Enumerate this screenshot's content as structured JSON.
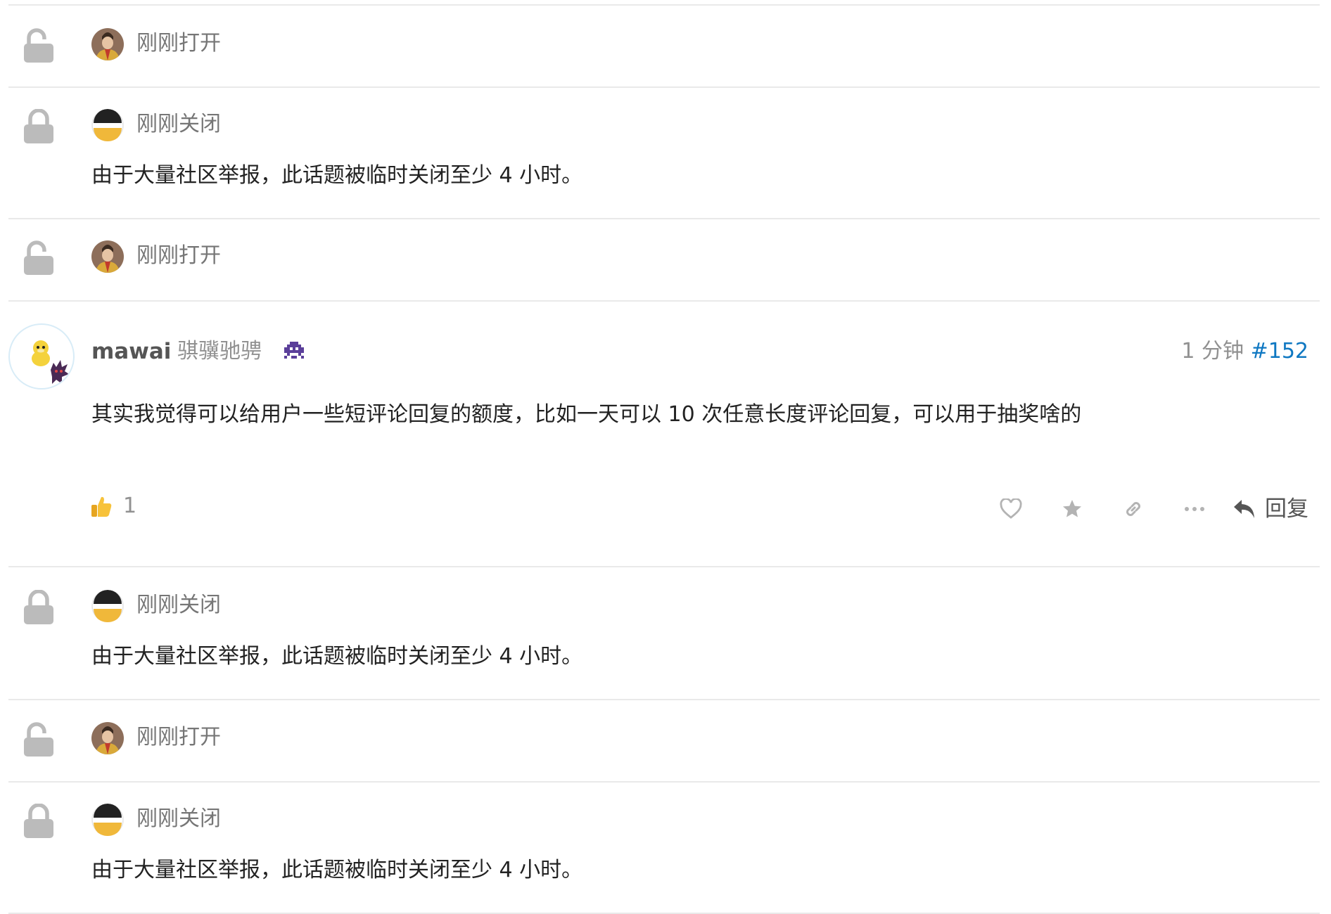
{
  "events": [
    {
      "type": "open",
      "avatar": "emperor-avatar",
      "label": "刚刚打开"
    },
    {
      "type": "close",
      "avatar": "system-avatar",
      "label": "刚刚关闭",
      "message": "由于大量社区举报，此话题被临时关闭至少 4 小时。"
    },
    {
      "type": "open",
      "avatar": "emperor-avatar",
      "label": "刚刚打开"
    },
    {
      "type": "close",
      "avatar": "system-avatar",
      "label": "刚刚关闭",
      "message": "由于大量社区举报，此话题被临时关闭至少 4 小时。"
    },
    {
      "type": "open",
      "avatar": "emperor-avatar",
      "label": "刚刚打开"
    },
    {
      "type": "close",
      "avatar": "system-avatar",
      "label": "刚刚关闭",
      "message": "由于大量社区举报，此话题被临时关闭至少 4 小时。"
    }
  ],
  "post": {
    "username": "mawai",
    "user_title": "骐骥驰骋",
    "flair_icon": "space-invader-icon",
    "time": "1 分钟",
    "post_number": "#152",
    "body": "其实我觉得可以给用户一些短评论回复的额度，比如一天可以 10 次任意长度评论回复，可以用于抽奖啥的",
    "reaction": {
      "icon": "thumbs-up-icon",
      "count": "1"
    },
    "actions": {
      "like_icon": "heart-icon",
      "bookmark_icon": "star-icon",
      "share_icon": "link-icon",
      "more_icon": "ellipsis-icon",
      "reply_icon": "reply-arrow-icon",
      "reply_label": "回复"
    }
  },
  "colors": {
    "link": "#0f78c2",
    "muted": "#919191",
    "divider": "#e9e9e9",
    "lock": "#bbbbbb"
  }
}
